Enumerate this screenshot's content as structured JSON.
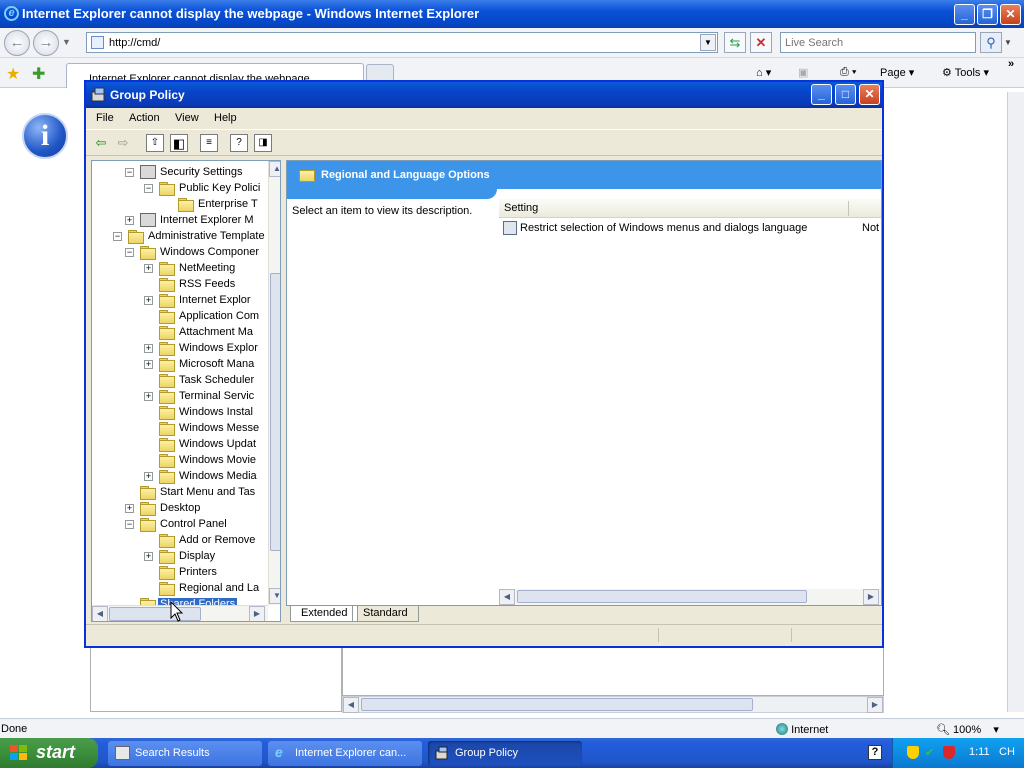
{
  "browser": {
    "title": "Internet Explorer cannot display the webpage - Windows Internet Explorer",
    "address": "http://cmd/",
    "search_placeholder": "Live Search",
    "tab_label": "Internet Explorer cannot display the webpage",
    "commands": [
      "Page",
      "Tools"
    ],
    "status_text": "Done",
    "zone": "Internet",
    "zoom": "100%"
  },
  "group_policy": {
    "title": "Group Policy",
    "menu": [
      "File",
      "Action",
      "View",
      "Help"
    ],
    "tree": [
      {
        "label": "Security Settings",
        "depth": 2,
        "exp": "−",
        "icon": "policy"
      },
      {
        "label": "Public Key Polici",
        "depth": 3,
        "exp": "−",
        "icon": "folder"
      },
      {
        "label": "Enterprise T",
        "depth": 4,
        "exp": "",
        "icon": "folder"
      },
      {
        "label": "Internet Explorer M",
        "depth": 2,
        "exp": "+",
        "icon": "policy"
      },
      {
        "label": "Administrative Template",
        "depth": 1,
        "exp": "−",
        "icon": "folder"
      },
      {
        "label": "Windows Componer",
        "depth": 2,
        "exp": "−",
        "icon": "folder"
      },
      {
        "label": "NetMeeting",
        "depth": 3,
        "exp": "+",
        "icon": "folder"
      },
      {
        "label": "RSS Feeds",
        "depth": 3,
        "exp": "",
        "icon": "folder"
      },
      {
        "label": "Internet Explor",
        "depth": 3,
        "exp": "+",
        "icon": "folder"
      },
      {
        "label": "Application Com",
        "depth": 3,
        "exp": "",
        "icon": "folder"
      },
      {
        "label": "Attachment Ma",
        "depth": 3,
        "exp": "",
        "icon": "folder"
      },
      {
        "label": "Windows Explor",
        "depth": 3,
        "exp": "+",
        "icon": "folder"
      },
      {
        "label": "Microsoft Mana",
        "depth": 3,
        "exp": "+",
        "icon": "folder"
      },
      {
        "label": "Task Scheduler",
        "depth": 3,
        "exp": "",
        "icon": "folder"
      },
      {
        "label": "Terminal Servic",
        "depth": 3,
        "exp": "+",
        "icon": "folder"
      },
      {
        "label": "Windows Instal",
        "depth": 3,
        "exp": "",
        "icon": "folder"
      },
      {
        "label": "Windows Messe",
        "depth": 3,
        "exp": "",
        "icon": "folder"
      },
      {
        "label": "Windows Updat",
        "depth": 3,
        "exp": "",
        "icon": "folder"
      },
      {
        "label": "Windows Movie",
        "depth": 3,
        "exp": "",
        "icon": "folder"
      },
      {
        "label": "Windows Media",
        "depth": 3,
        "exp": "+",
        "icon": "folder"
      },
      {
        "label": "Start Menu and Tas",
        "depth": 2,
        "exp": "",
        "icon": "folder"
      },
      {
        "label": "Desktop",
        "depth": 2,
        "exp": "+",
        "icon": "folder"
      },
      {
        "label": "Control Panel",
        "depth": 2,
        "exp": "−",
        "icon": "folder"
      },
      {
        "label": "Add or Remove",
        "depth": 3,
        "exp": "",
        "icon": "folder"
      },
      {
        "label": "Display",
        "depth": 3,
        "exp": "+",
        "icon": "folder"
      },
      {
        "label": "Printers",
        "depth": 3,
        "exp": "",
        "icon": "folder"
      },
      {
        "label": "Regional and La",
        "depth": 3,
        "exp": "",
        "icon": "folder"
      },
      {
        "label": "Shared Folders",
        "depth": 2,
        "exp": "",
        "icon": "folder",
        "selected": true
      }
    ],
    "pane_header": "Regional and Language Options",
    "description": "Select an item to view its description.",
    "column_setting": "Setting",
    "settings": [
      {
        "name": "Restrict selection of Windows menus and dialogs language",
        "state": "Not"
      }
    ],
    "view_tabs": [
      "Extended",
      "Standard"
    ]
  },
  "taskbar": {
    "start_label": "start",
    "buttons": [
      {
        "label": "Search Results",
        "active": false
      },
      {
        "label": "Internet Explorer can...",
        "active": false
      },
      {
        "label": "Group Policy",
        "active": true
      }
    ],
    "language": "CH",
    "clock": "1:11"
  },
  "colors": {
    "xp_title_blue": "#0a50d8",
    "pane_header_blue": "#3d95ea",
    "start_green": "#3c8f3c",
    "selection_blue": "#316ac5"
  }
}
